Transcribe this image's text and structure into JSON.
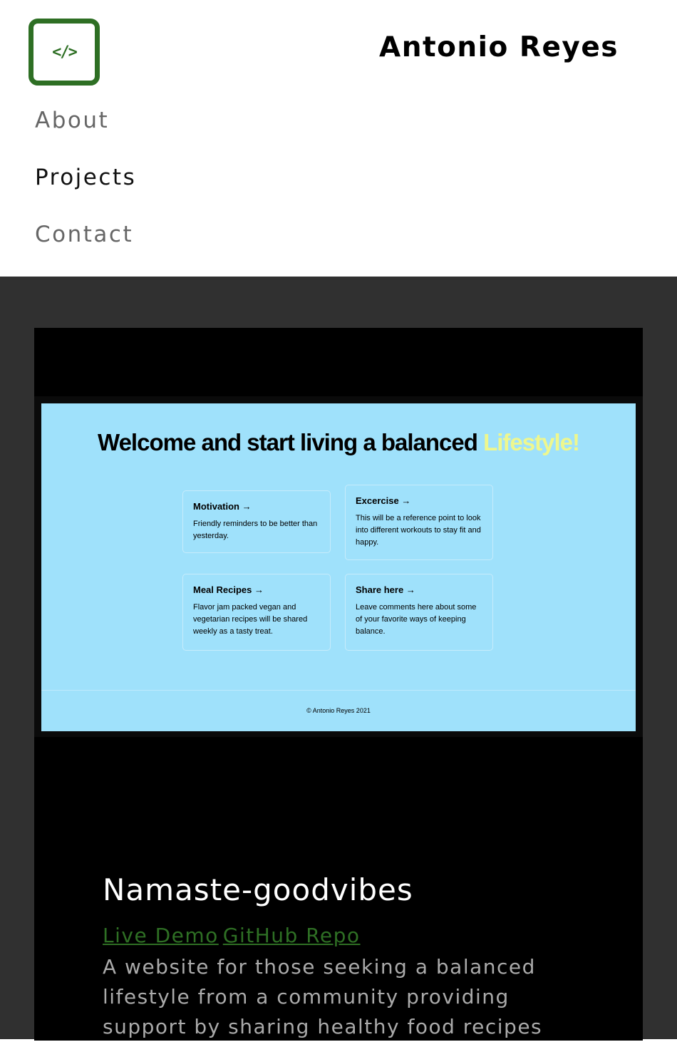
{
  "header": {
    "logo_icon": "code-icon",
    "logo_glyph": "</>",
    "site_name": "Antonio Reyes",
    "nav": [
      {
        "label": "About"
      },
      {
        "label": "Projects"
      },
      {
        "label": "Contact"
      }
    ]
  },
  "project": {
    "preview": {
      "title_main": "Welcome and start living a balanced ",
      "title_accent": "Lifestyle!",
      "cards": [
        {
          "title": "Motivation →",
          "text": "Friendly reminders to be better than yesterday."
        },
        {
          "title": "Excercise →",
          "text": "This will be a reference point to look into different workouts to stay fit and happy."
        },
        {
          "title": "Meal Recipes →",
          "text": "Flavor jam packed vegan and vegetarian recipes will be shared weekly as a tasty treat."
        },
        {
          "title": "Share here →",
          "text": "Leave comments here about some of your favorite ways of keeping balance."
        }
      ],
      "footer": "© Antonio Reyes 2021"
    },
    "title": "Namaste-goodvibes",
    "live_demo_label": "Live Demo",
    "repo_label": "GitHub Repo",
    "description": "A website for those seeking a balanced lifestyle from a community providing support by sharing healthy food recipes"
  },
  "colors": {
    "brand_green": "#2e6f24",
    "preview_bg": "#9fe1fb",
    "accent_yellow": "#eef78e",
    "section_bg": "#303030"
  }
}
